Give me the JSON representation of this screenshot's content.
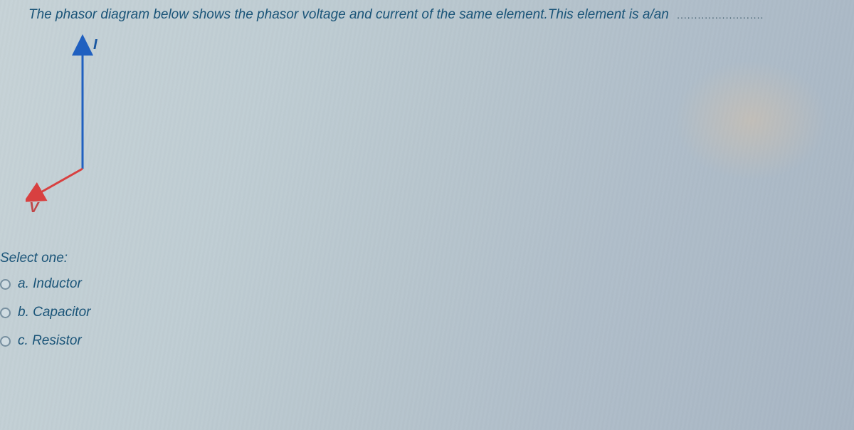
{
  "question": {
    "prompt": "The phasor diagram below shows the phasor voltage and current of the same element.This element is a/an",
    "blank": "........................."
  },
  "diagram": {
    "current_label": "I",
    "voltage_label": "V"
  },
  "select_text": "Select one:",
  "options": [
    {
      "letter": "a.",
      "text": "Inductor"
    },
    {
      "letter": "b.",
      "text": "Capacitor"
    },
    {
      "letter": "c.",
      "text": "Resistor"
    }
  ]
}
